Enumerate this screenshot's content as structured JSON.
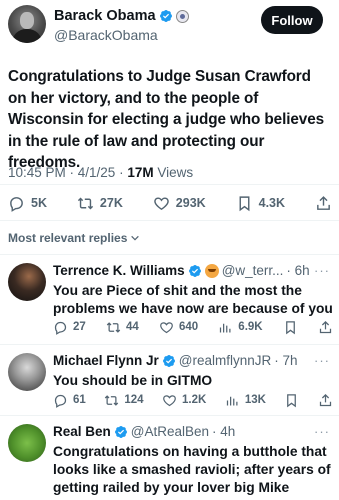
{
  "tweet": {
    "author_name": "Barack Obama",
    "author_handle": "@BarackObama",
    "follow_label": "Follow",
    "text": "Congratulations to Judge Susan Crawford on her victory, and to the people of Wisconsin for electing a judge who believes in the rule of law and protecting our freedoms.",
    "time": "10:45 PM · 4/1/25 · ",
    "views_count": "17M",
    "views_label": " Views",
    "replies": "5K",
    "reposts": "27K",
    "likes": "293K",
    "bookmarks": "4.3K"
  },
  "replies_filter": {
    "label": "Most relevant replies"
  },
  "replies": [
    {
      "name": "Terrence K. Williams",
      "handle": "@w_terr...",
      "time": "· 6h",
      "text": "You are Piece of shit and the most the problems we have now are because of you",
      "comments": "27",
      "reposts": "44",
      "likes": "640",
      "views": "6.9K"
    },
    {
      "name": "Michael Flynn Jr",
      "handle": "@realmflynnJR",
      "time": "· 7h",
      "text": "You should be in GITMO",
      "comments": "61",
      "reposts": "124",
      "likes": "1.2K",
      "views": "13K"
    },
    {
      "name": "Real Ben",
      "handle": "@AtRealBen",
      "time": "· 4h",
      "text": "Congratulations on having a butthole that looks like a smashed ravioli; after years of getting railed by your lover big Mike"
    }
  ],
  "more_symbol": "···",
  "colors": {
    "verified": "#1d9bf0",
    "text": "#0f1419",
    "muted": "#536471",
    "follow_bg": "#0f1419"
  }
}
